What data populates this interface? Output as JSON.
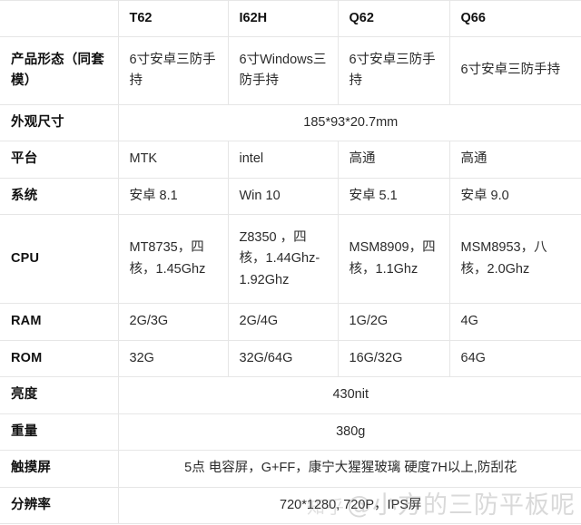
{
  "table": {
    "corner_label": "",
    "columns": [
      "T62",
      "I62H",
      "Q62",
      "Q66"
    ],
    "rows": [
      {
        "label": "产品形态（同套模）",
        "merged": false,
        "cells": [
          "6寸安卓三防手持",
          "6寸Windows三防手持",
          "6寸安卓三防手持",
          "6寸安卓三防手持"
        ]
      },
      {
        "label": "外观尺寸",
        "merged": true,
        "merged_value": "185*93*20.7mm",
        "cells": []
      },
      {
        "label": "平台",
        "merged": false,
        "cells": [
          "MTK",
          "intel",
          "高通",
          "高通"
        ]
      },
      {
        "label": "系统",
        "merged": false,
        "cells": [
          "安卓 8.1",
          "Win 10",
          "安卓 5.1",
          "安卓 9.0"
        ]
      },
      {
        "label": "CPU",
        "merged": false,
        "cells": [
          "MT8735，四核，1.45Ghz",
          "Z8350 ，四核，1.44Ghz-1.92Ghz",
          "MSM8909，四核，1.1Ghz",
          "MSM8953，八核，2.0Ghz"
        ]
      },
      {
        "label": "RAM",
        "merged": false,
        "cells": [
          "2G/3G",
          "2G/4G",
          "1G/2G",
          "4G"
        ]
      },
      {
        "label": "ROM",
        "merged": false,
        "cells": [
          "32G",
          "32G/64G",
          "16G/32G",
          "64G"
        ]
      },
      {
        "label": "亮度",
        "merged": true,
        "merged_value": "430nit",
        "cells": []
      },
      {
        "label": "重量",
        "merged": true,
        "merged_value": "380g",
        "cells": []
      },
      {
        "label": "触摸屏",
        "merged": true,
        "merged_value": "5点 电容屏，G+FF，康宁大猩猩玻璃 硬度7H以上,防刮花",
        "cells": []
      },
      {
        "label": "分辨率",
        "merged": true,
        "merged_value": "720*1280, 720P，IPS屏",
        "cells": []
      }
    ]
  },
  "watermark": {
    "logo": "知乎",
    "text": "@小方的三防平板呢"
  },
  "colors": {
    "border": "#e6e6e6",
    "label_text": "#111111",
    "cell_text": "#2b2b2b",
    "background": "#ffffff",
    "watermark": "#8c8c8c"
  }
}
